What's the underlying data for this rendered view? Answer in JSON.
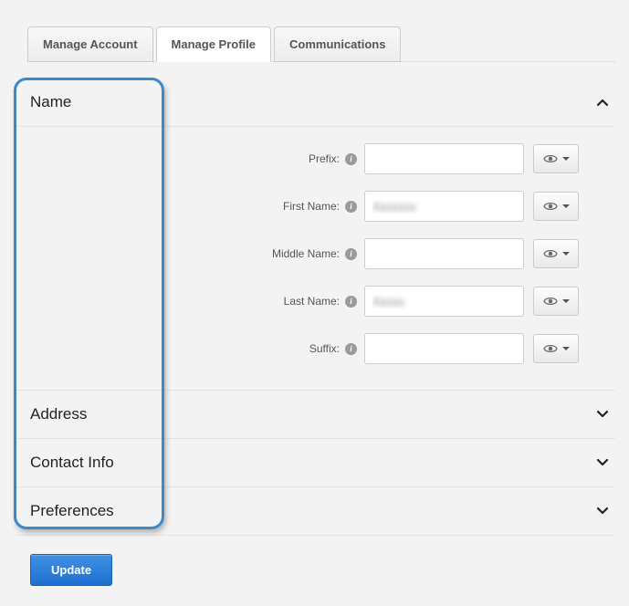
{
  "tabs": [
    {
      "label": "Manage Account"
    },
    {
      "label": "Manage Profile"
    },
    {
      "label": "Communications"
    }
  ],
  "sections": {
    "name": {
      "title": "Name",
      "fields": {
        "prefix": {
          "label": "Prefix:",
          "value": ""
        },
        "firstName": {
          "label": "First Name:",
          "value": "Xxxxxxx"
        },
        "middleName": {
          "label": "Middle Name:",
          "value": ""
        },
        "lastName": {
          "label": "Last Name:",
          "value": "Xxxxx"
        },
        "suffix": {
          "label": "Suffix:",
          "value": ""
        }
      }
    },
    "address": {
      "title": "Address"
    },
    "contactInfo": {
      "title": "Contact Info"
    },
    "preferences": {
      "title": "Preferences"
    }
  },
  "buttons": {
    "update": "Update"
  }
}
